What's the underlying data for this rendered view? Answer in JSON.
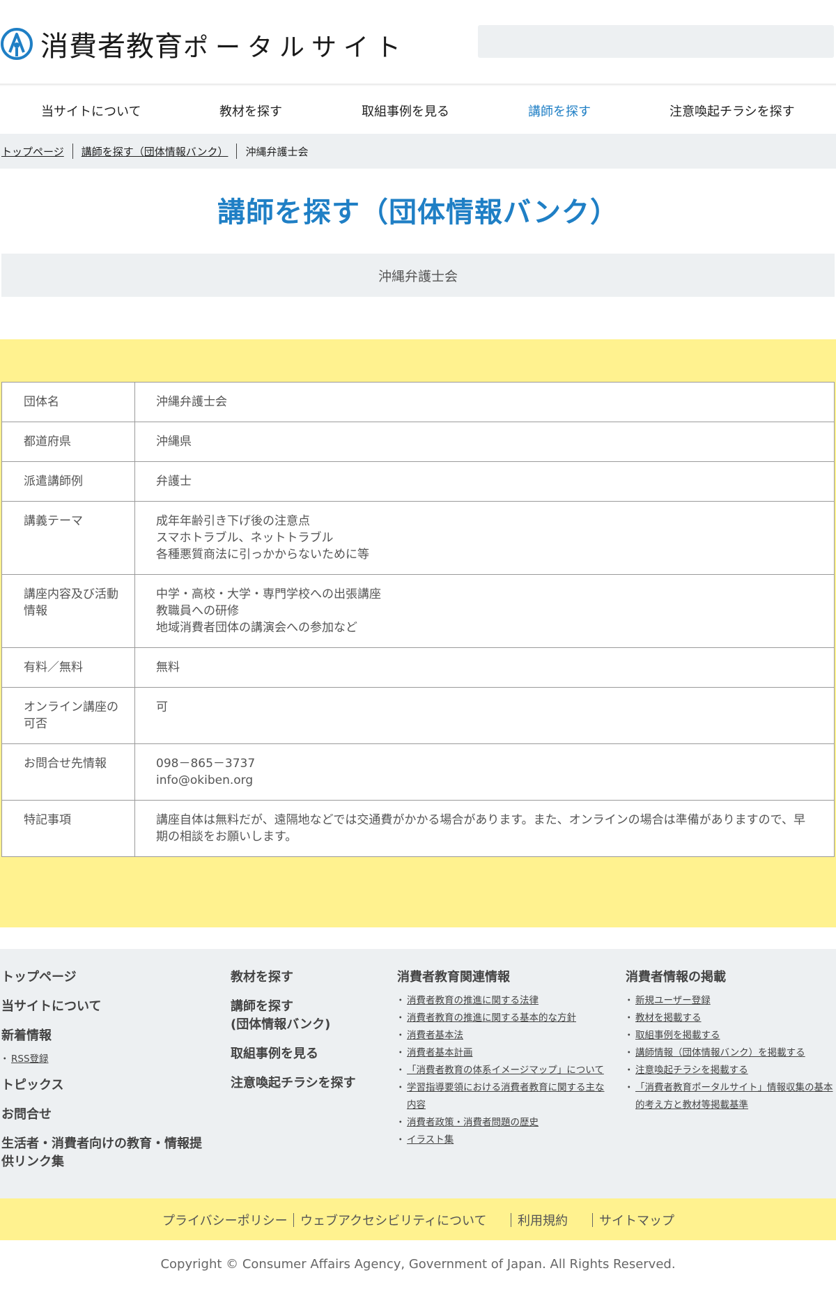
{
  "header": {
    "logo_main": "消費者教育",
    "logo_sub": "ポータルサイト",
    "search_placeholder": ""
  },
  "nav": {
    "items": [
      {
        "label": "当サイトについて"
      },
      {
        "label": "教材を探す"
      },
      {
        "label": "取組事例を見る"
      },
      {
        "label": "講師を探す"
      },
      {
        "label": "注意喚起チラシを探す"
      }
    ]
  },
  "breadcrumb": {
    "top": "トップページ",
    "parent": "講師を探す（団体情報バンク）",
    "current": "沖縄弁護士会"
  },
  "page": {
    "title": "講師を探す（団体情報バンク）",
    "subtitle": "沖縄弁護士会"
  },
  "table": {
    "rows": [
      {
        "label": "団体名",
        "lines": [
          "沖縄弁護士会"
        ]
      },
      {
        "label": "都道府県",
        "lines": [
          "沖縄県"
        ]
      },
      {
        "label": "派遣講師例",
        "lines": [
          "弁護士"
        ]
      },
      {
        "label": "講義テーマ",
        "lines": [
          "成年年齢引き下げ後の注意点",
          "スマホトラブル、ネットトラブル",
          "各種悪質商法に引っかからないために等"
        ]
      },
      {
        "label": "講座内容及び活動情報",
        "lines": [
          "中学・高校・大学・専門学校への出張講座",
          "教職員への研修",
          "地域消費者団体の講演会への参加など"
        ]
      },
      {
        "label": "有料／無料",
        "lines": [
          "無料"
        ]
      },
      {
        "label": "オンライン講座の可否",
        "lines": [
          "可"
        ]
      },
      {
        "label": "お問合せ先情報",
        "lines": [
          "098－865－3737",
          "info@okiben.org"
        ]
      },
      {
        "label": "特記事項",
        "lines": [
          "講座自体は無料だが、遠隔地などでは交通費がかかる場合があります。また、オンラインの場合は準備がありますので、早期の相談をお願いします。"
        ]
      }
    ]
  },
  "footer": {
    "col1": {
      "top": "トップページ",
      "about": "当サイトについて",
      "news": "新着情報",
      "rss": "RSS登録",
      "topics": "トピックス",
      "contact": "お問合せ",
      "links": "生活者・消費者向けの教育・情報提供リンク集"
    },
    "col2": {
      "materials": "教材を探す",
      "lecturers": "講師を探す\n(団体情報バンク)",
      "cases": "取組事例を見る",
      "flyers": "注意喚起チラシを探す"
    },
    "col3": {
      "heading": "消費者教育関連情報",
      "items": [
        "消費者教育の推進に関する法律",
        "消費者教育の推進に関する基本的な方針",
        "消費者基本法",
        "消費者基本計画",
        "「消費者教育の体系イメージマップ」について",
        "学習指導要領における消費者教育に関する主な内容",
        "消費者政策・消費者問題の歴史",
        "イラスト集"
      ]
    },
    "col4": {
      "heading": "消費者情報の掲載",
      "items": [
        "新規ユーザー登録",
        "教材を掲載する",
        "取組事例を掲載する",
        "講師情報（団体情報バンク）を掲載する",
        "注意喚起チラシを掲載する",
        "「消費者教育ポータルサイト」情報収集の基本的考え方と教材等掲載基準"
      ]
    }
  },
  "bottom_links": {
    "privacy": "プライバシーポリシー",
    "accessibility": "ウェブアクセシビリティについて",
    "terms": "利用規約",
    "sitemap": "サイトマップ"
  },
  "copyright": "Copyright © Consumer Affairs Agency, Government of Japan. All Rights Reserved.",
  "colors": {
    "accent": "#1f7fc5",
    "yellow": "#fff28f",
    "gray": "#edf0f2"
  }
}
